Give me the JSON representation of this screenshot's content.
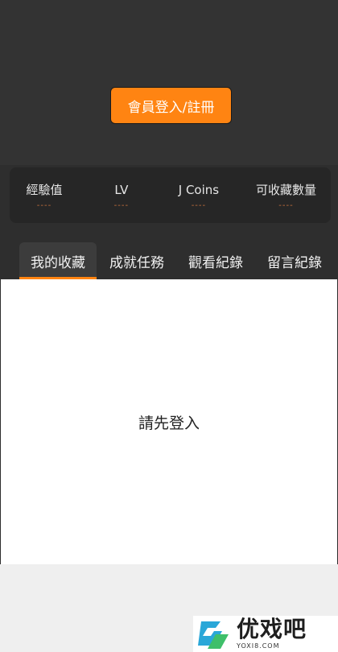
{
  "header": {
    "login_button_label": "會員登入/註冊"
  },
  "stats": {
    "items": [
      {
        "label": "經驗值",
        "value": "----"
      },
      {
        "label": "LV",
        "value": "----"
      },
      {
        "label": "J Coins",
        "value": "----"
      },
      {
        "label": "可收藏數量",
        "value": "----"
      }
    ]
  },
  "tabs": [
    {
      "label": "我的收藏",
      "active": true
    },
    {
      "label": "成就任務",
      "active": false
    },
    {
      "label": "觀看紀錄",
      "active": false
    },
    {
      "label": "留言紀錄",
      "active": false
    }
  ],
  "content": {
    "prompt": "請先登入"
  },
  "watermark": {
    "brand": "优戏吧",
    "url": "YOXI8.COM"
  },
  "colors": {
    "accent": "#ff8412",
    "header_bg": "#333333",
    "card_bg": "#262626",
    "content_bg": "#ffffff"
  }
}
